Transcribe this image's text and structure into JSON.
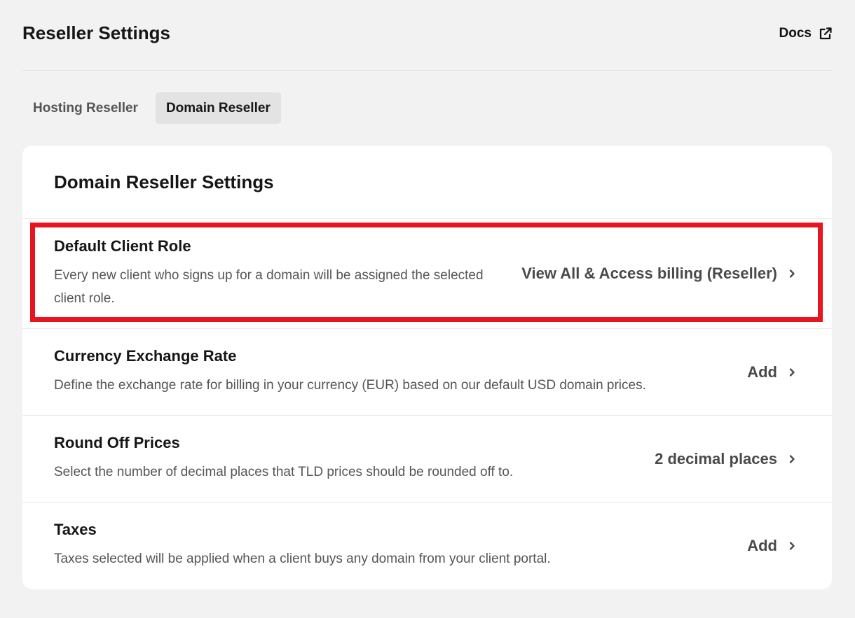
{
  "header": {
    "title": "Reseller Settings",
    "docs_label": "Docs",
    "docs_icon": "external-link-icon"
  },
  "tabs": [
    {
      "label": "Hosting Reseller",
      "active": false
    },
    {
      "label": "Domain Reseller",
      "active": true
    }
  ],
  "card": {
    "title": "Domain Reseller Settings",
    "rows": [
      {
        "title": "Default Client Role",
        "description": "Every new client who signs up for a domain will be assigned the selected client role.",
        "value": "View All & Access billing (Reseller)"
      },
      {
        "title": "Currency Exchange Rate",
        "description": "Define the exchange rate for billing in your currency (EUR) based on our default USD domain prices.",
        "value": "Add"
      },
      {
        "title": "Round Off Prices",
        "description": "Select the number of decimal places that TLD prices should be rounded off to.",
        "value": "2 decimal places"
      },
      {
        "title": "Taxes",
        "description": "Taxes selected will be applied when a client buys any domain from your client portal.",
        "value": "Add"
      }
    ]
  },
  "colors": {
    "background": "#f2f2f2",
    "card": "#ffffff",
    "highlight": "#e8141f",
    "active_tab": "#e3e3e3"
  }
}
